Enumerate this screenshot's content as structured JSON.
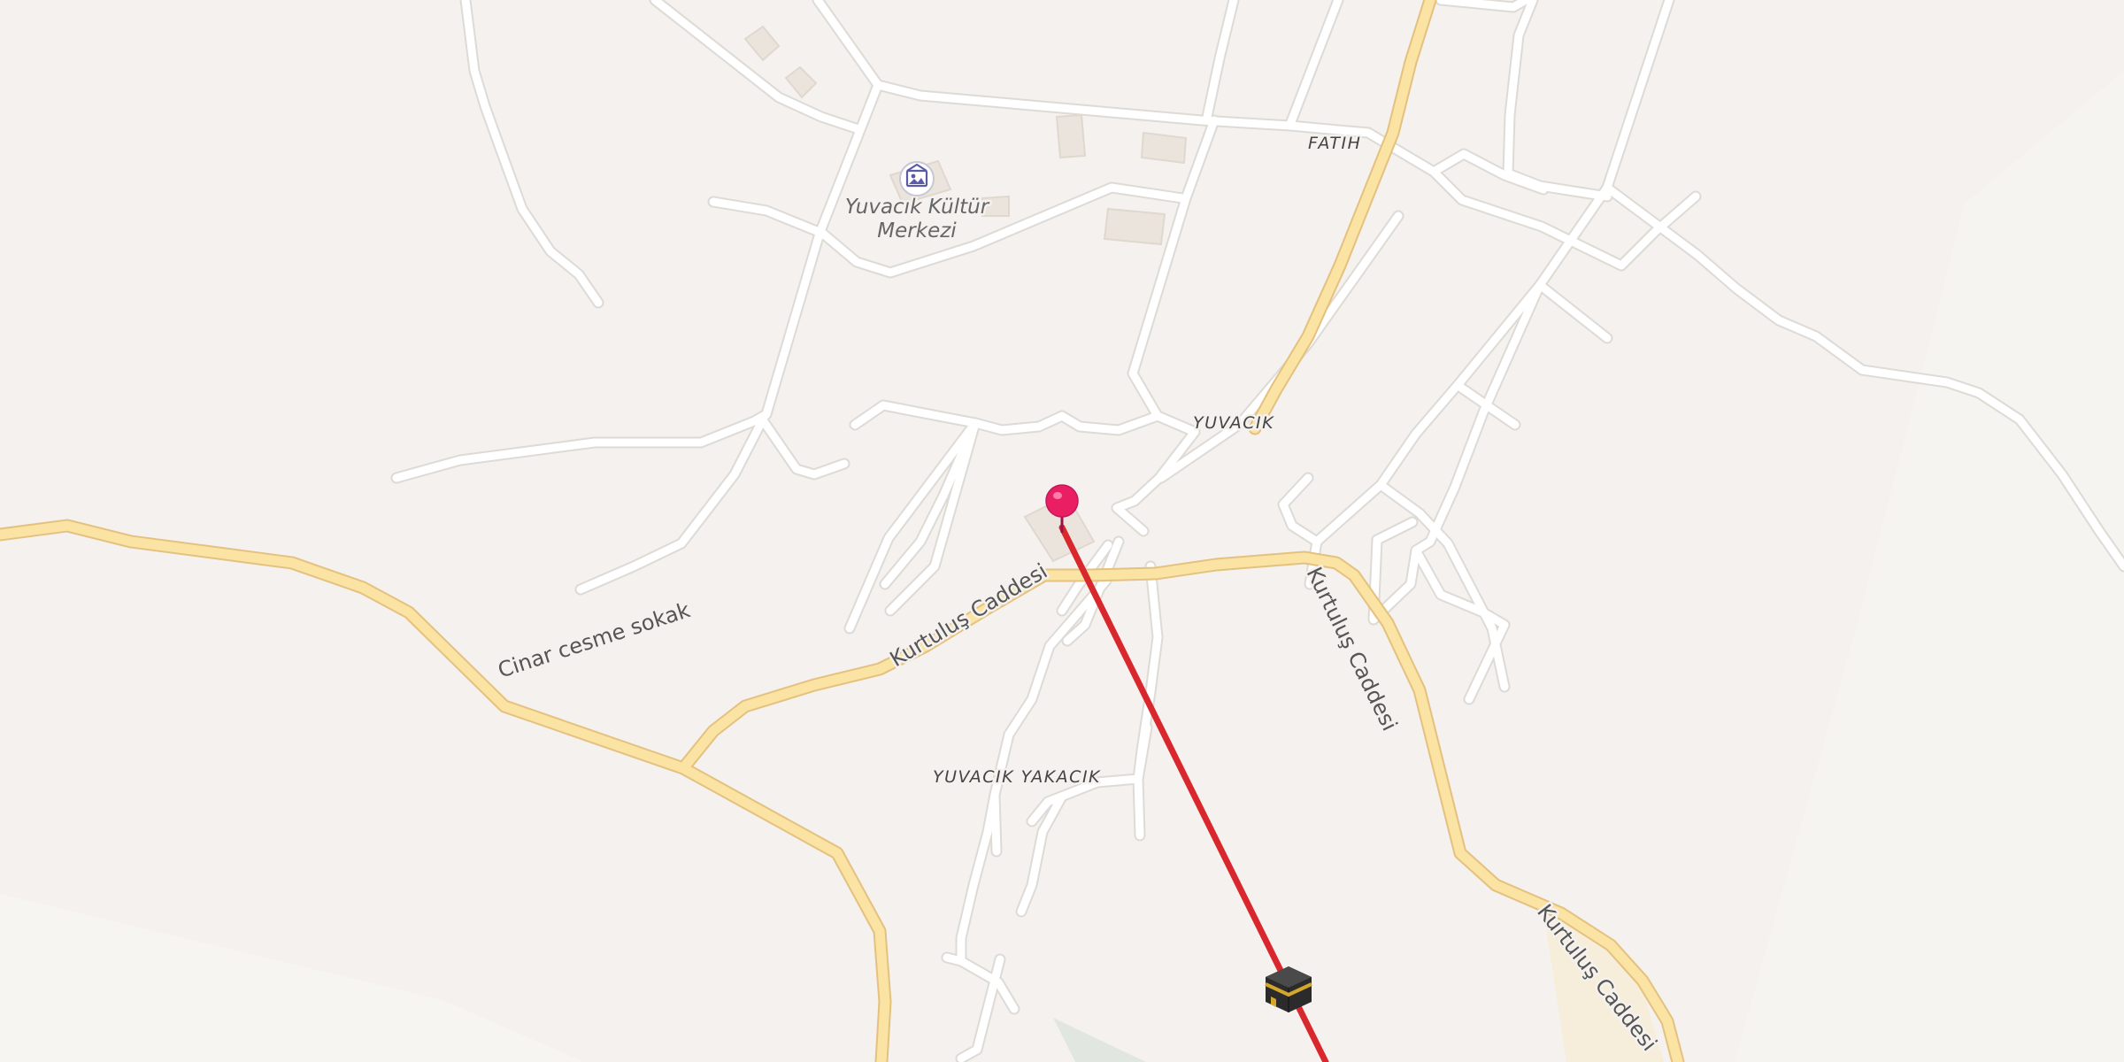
{
  "map": {
    "colors": {
      "background": "#f4f1ee",
      "minor_road": "#ffffff",
      "minor_road_casing": "#dedad5",
      "major_road": "#fbe3a3",
      "major_road_casing": "#e4c17f",
      "building": "#ebe4dd",
      "qibla_line": "#d9272e",
      "pin": "#e91e63"
    },
    "area_labels": {
      "fatih": "FATIH",
      "yuvacik": "YUVACIK",
      "yuvacik_yakacik": "YUVACIK YAKACIK"
    },
    "road_labels": {
      "kurtulus_1": "Kurtuluş Caddesi",
      "kurtulus_2": "Kurtuluş Caddesi",
      "kurtulus_3": "Kurtuluş Caddesi",
      "cinar": "Cinar cesme sokak"
    },
    "poi": {
      "name_line1": "Yuvacık Kültür",
      "name_line2": "Merkezi",
      "icon": "gallery-icon"
    },
    "markers": {
      "location_pin": "pin-icon",
      "destination": "kaaba-icon"
    }
  }
}
